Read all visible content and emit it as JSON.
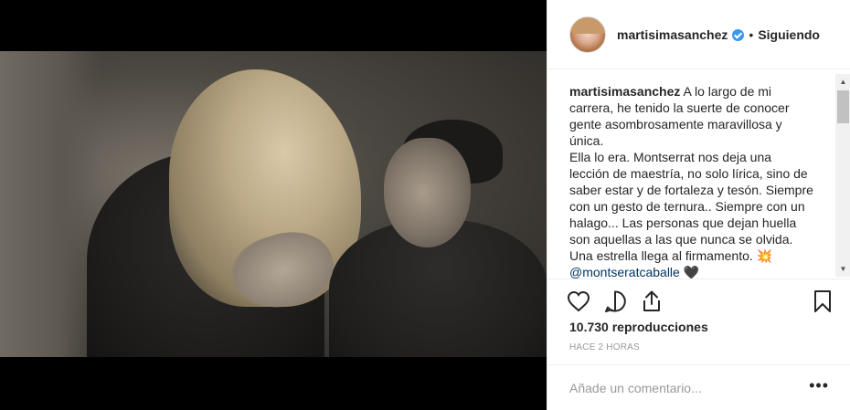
{
  "post": {
    "username": "martisimasanchez",
    "separator": "•",
    "follow_label": "Siguiendo",
    "caption_user": "martisimasanchez",
    "caption_lines": [
      "A lo largo de mi carrera, he tenido la suerte de conocer gente asombrosamente maravillosa y única.",
      "Ella lo era. Montserrat nos deja una lección de maestría, no solo lírica, sino de saber estar y de fortaleza y tesón. Siempre con un gesto de ternura.. Siempre con un halago... Las personas que dejan huella son aquellas a las que nunca se olvida.",
      "Una estrella llega al firmamento. 💥"
    ],
    "mention": "@montseratcaballe",
    "mention_emoji": "🖤",
    "views": "10.730 reproducciones",
    "time": "HACE 2 HORAS",
    "comment_placeholder": "Añade un comentario...",
    "more_label": "•••"
  },
  "icons": {
    "verified": "verified-badge-icon",
    "like": "heart-icon",
    "comment": "comment-icon",
    "share": "share-icon",
    "save": "bookmark-icon",
    "more": "more-options-icon"
  },
  "colors": {
    "verified": "#3897f0",
    "mention": "#003569",
    "muted": "#999999",
    "text": "#262626",
    "border": "#efefef"
  }
}
